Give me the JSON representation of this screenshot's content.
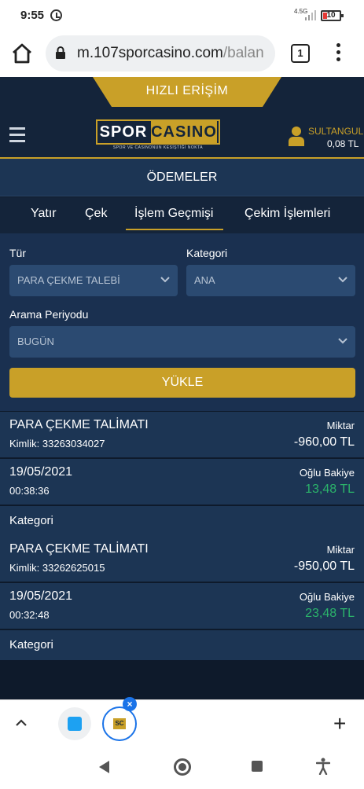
{
  "status": {
    "time": "9:55",
    "network": "4.5G",
    "battery": "10"
  },
  "browser": {
    "url_host": "m.107sporcasino.com",
    "url_rest": "/balan",
    "tab_count": "1"
  },
  "site": {
    "quick_access": "HIZLI ERİŞİM",
    "logo_left": "SPOR",
    "logo_right": "CASINO",
    "logo_tagline": "SPOR VE CASINONUN KESİŞTİĞİ NOKTA",
    "username": "SULTANGUL",
    "balance": "0,08  TL"
  },
  "section_title": "ÖDEMELER",
  "tabs": [
    {
      "label": "Yatır"
    },
    {
      "label": "Çek"
    },
    {
      "label": "İşlem Geçmişi"
    },
    {
      "label": "Çekim İşlemleri"
    }
  ],
  "filters": {
    "type_label": "Tür",
    "type_value": "PARA ÇEKME TALEBİ",
    "category_label": "Kategori",
    "category_value": "ANA",
    "period_label": "Arama Periyodu",
    "period_value": "BUGÜN",
    "load_button": "YÜKLE"
  },
  "transactions": [
    {
      "title": "PARA ÇEKME TALİMATI",
      "id": "Kimlik: 33263034027",
      "amount_label": "Miktar",
      "amount": "-960,00 TL",
      "date": "19/05/2021",
      "time": "00:38:36",
      "balance_label": "Oğlu Bakiye",
      "balance": "13,48 TL",
      "category_label": "Kategori"
    },
    {
      "title": "PARA ÇEKME TALİMATI",
      "id": "Kimlik: 33262625015",
      "amount_label": "Miktar",
      "amount": "-950,00 TL",
      "date": "19/05/2021",
      "time": "00:32:48",
      "balance_label": "Oğlu Bakiye",
      "balance": "23,48 TL",
      "category_label": "Kategori"
    }
  ],
  "bottom": {
    "tab_badge": "SC"
  },
  "colors": {
    "gold": "#c9a028",
    "navy": "#14243a",
    "panel": "#1c3554",
    "green": "#2bb36a"
  }
}
